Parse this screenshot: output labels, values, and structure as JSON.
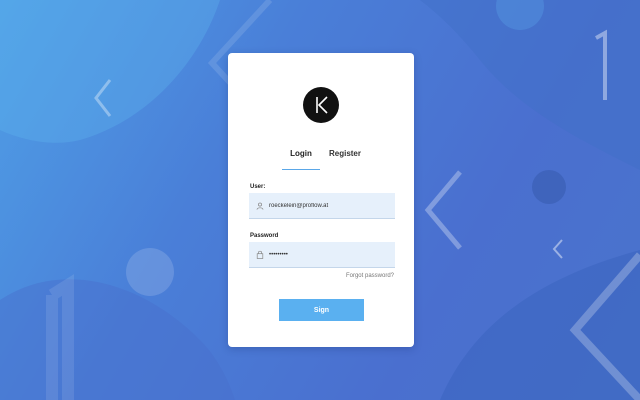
{
  "logo": {
    "letter": "K"
  },
  "tabs": {
    "login": "Login",
    "register": "Register"
  },
  "form": {
    "user_label": "User:",
    "user_value": "roeckelein@proflow.at",
    "password_label": "Password",
    "password_value": "•••••••••",
    "forgot": "Forgot password?",
    "submit": "Sign"
  },
  "colors": {
    "accent": "#5ab0f0",
    "field_bg": "#e6f0fb",
    "background": "#4a7fd8"
  },
  "icons": {
    "user": "user-icon",
    "password": "lock-icon"
  }
}
